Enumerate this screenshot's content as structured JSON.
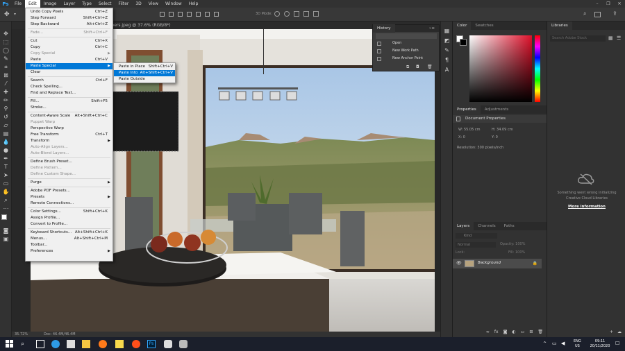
{
  "app": {
    "logo": "Ps"
  },
  "menubar": {
    "items": [
      "File",
      "Edit",
      "Image",
      "Layer",
      "Type",
      "Select",
      "Filter",
      "3D",
      "View",
      "Window",
      "Help"
    ]
  },
  "window_controls": {
    "minimize": "–",
    "maximize": "❐",
    "close": "✕"
  },
  "options": {
    "mode_label": "3D Mode:"
  },
  "document": {
    "tab_title": "wallpapers.jpeg @ 37.6% (RGB/8*)",
    "zoom": "35.72%",
    "doc_size": "Doc: 46.4M/46.4M"
  },
  "edit_menu": {
    "items": [
      {
        "label": "Undo Copy Pixels",
        "shortcut": "Ctrl+Z",
        "enabled": true
      },
      {
        "label": "Step Forward",
        "shortcut": "Shift+Ctrl+Z",
        "enabled": true
      },
      {
        "label": "Step Backward",
        "shortcut": "Alt+Ctrl+Z",
        "enabled": true
      },
      {
        "sep": true
      },
      {
        "label": "Fade...",
        "shortcut": "Shift+Ctrl+F",
        "enabled": false
      },
      {
        "sep": true
      },
      {
        "label": "Cut",
        "shortcut": "Ctrl+X",
        "enabled": true
      },
      {
        "label": "Copy",
        "shortcut": "Ctrl+C",
        "enabled": true
      },
      {
        "label": "Copy Special",
        "enabled": false,
        "submenu": true
      },
      {
        "label": "Paste",
        "shortcut": "Ctrl+V",
        "enabled": true
      },
      {
        "label": "Paste Special",
        "enabled": true,
        "submenu": true,
        "highlighted": true
      },
      {
        "label": "Clear",
        "enabled": true
      },
      {
        "sep": true
      },
      {
        "label": "Search",
        "shortcut": "Ctrl+F",
        "enabled": true
      },
      {
        "label": "Check Spelling...",
        "enabled": true
      },
      {
        "label": "Find and Replace Text...",
        "enabled": true
      },
      {
        "sep": true
      },
      {
        "label": "Fill...",
        "shortcut": "Shift+F5",
        "enabled": true
      },
      {
        "label": "Stroke...",
        "enabled": true
      },
      {
        "sep": true
      },
      {
        "label": "Content-Aware Scale",
        "shortcut": "Alt+Shift+Ctrl+C",
        "enabled": true
      },
      {
        "label": "Puppet Warp",
        "enabled": false
      },
      {
        "label": "Perspective Warp",
        "enabled": true
      },
      {
        "label": "Free Transform",
        "shortcut": "Ctrl+T",
        "enabled": true
      },
      {
        "label": "Transform",
        "enabled": true,
        "submenu": true
      },
      {
        "label": "Auto-Align Layers...",
        "enabled": false
      },
      {
        "label": "Auto-Blend Layers...",
        "enabled": false
      },
      {
        "sep": true
      },
      {
        "label": "Define Brush Preset...",
        "enabled": true
      },
      {
        "label": "Define Pattern...",
        "enabled": false
      },
      {
        "label": "Define Custom Shape...",
        "enabled": false
      },
      {
        "sep": true
      },
      {
        "label": "Purge",
        "enabled": true,
        "submenu": true
      },
      {
        "sep": true
      },
      {
        "label": "Adobe PDF Presets...",
        "enabled": true
      },
      {
        "label": "Presets",
        "enabled": true,
        "submenu": true
      },
      {
        "label": "Remote Connections...",
        "enabled": true
      },
      {
        "sep": true
      },
      {
        "label": "Color Settings...",
        "shortcut": "Shift+Ctrl+K",
        "enabled": true
      },
      {
        "label": "Assign Profile...",
        "enabled": true
      },
      {
        "label": "Convert to Profile...",
        "enabled": true
      },
      {
        "sep": true
      },
      {
        "label": "Keyboard Shortcuts...",
        "shortcut": "Alt+Shift+Ctrl+K",
        "enabled": true
      },
      {
        "label": "Menus...",
        "shortcut": "Alt+Shift+Ctrl+M",
        "enabled": true
      },
      {
        "label": "Toolbar...",
        "enabled": true
      },
      {
        "label": "Preferences",
        "enabled": true,
        "submenu": true
      }
    ]
  },
  "paste_special_menu": {
    "items": [
      {
        "label": "Paste in Place",
        "shortcut": "Shift+Ctrl+V",
        "highlighted": false
      },
      {
        "label": "Paste Into",
        "shortcut": "Alt+Shift+Ctrl+V",
        "highlighted": true
      },
      {
        "label": "Paste Outside",
        "shortcut": "",
        "highlighted": false
      }
    ]
  },
  "history": {
    "title": "History",
    "items": [
      "Open",
      "New Work Path",
      "New Anchor Point"
    ]
  },
  "color_panel": {
    "tabs": [
      "Color",
      "Swatches"
    ]
  },
  "properties_panel": {
    "tabs": [
      "Properties",
      "Adjustments"
    ],
    "section": "Document Properties",
    "w_label": "W:",
    "w_value": "55.05 cm",
    "h_label": "H:",
    "h_value": "34.09 cm",
    "x_label": "X:",
    "x_value": "0",
    "y_label": "Y:",
    "y_value": "0",
    "resolution": "Resolution: 300 pixels/inch"
  },
  "layers_panel": {
    "tabs": [
      "Layers",
      "Channels",
      "Paths"
    ],
    "kind_label": "Kind",
    "blend_mode": "Normal",
    "opacity_label": "Opacity:",
    "opacity_value": "100%",
    "lock_label": "Lock:",
    "fill_label": "Fill:",
    "fill_value": "100%",
    "layer_name": "Background"
  },
  "libraries_panel": {
    "title": "Libraries",
    "search_placeholder": "Search Adobe Stock",
    "message": "Something went wrong initializing Creative Cloud Libraries",
    "link": "More information"
  },
  "taskbar": {
    "lang1": "ENG",
    "lang2": "US",
    "time": "09:11",
    "date": "20/11/2020"
  },
  "colors": {
    "accent": "#0078d7",
    "ps_blue": "#31a8ff"
  }
}
